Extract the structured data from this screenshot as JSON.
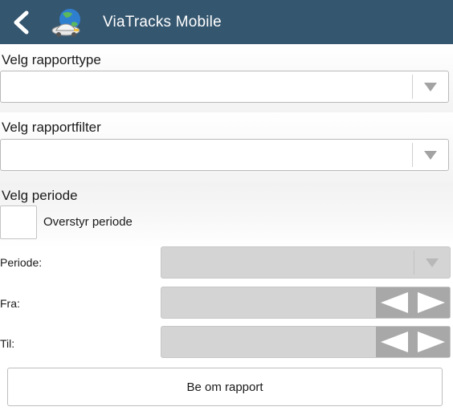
{
  "header": {
    "title": "ViaTracks Mobile",
    "back_icon": "chevron-left-icon",
    "app_icon": "globe-car-icon",
    "bg_color": "#35566f"
  },
  "report_type": {
    "label": "Velg rapporttype",
    "value": ""
  },
  "report_filter": {
    "label": "Velg rapportfilter",
    "value": ""
  },
  "period": {
    "heading": "Velg periode",
    "override_label": "Overstyr periode",
    "override_checked": false,
    "period_label": "Periode:",
    "period_value": "",
    "from_label": "Fra:",
    "from_value": "",
    "to_label": "Til:",
    "to_value": ""
  },
  "submit_label": "Be om rapport"
}
